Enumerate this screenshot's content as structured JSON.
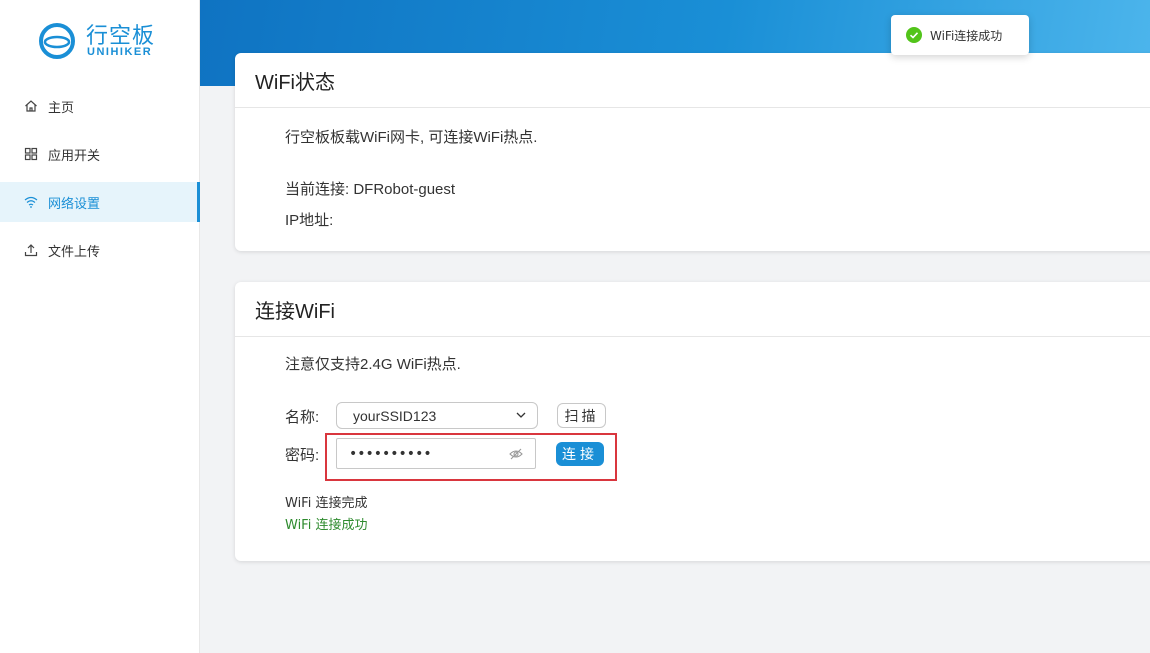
{
  "brand": {
    "title": "行空板",
    "subtitle": "UNIHIKER",
    "accent": "#1a8fd6"
  },
  "sidebar": {
    "items": [
      {
        "label": "主页",
        "icon": "home-icon",
        "active": false
      },
      {
        "label": "应用开关",
        "icon": "grid-icon",
        "active": false
      },
      {
        "label": "网络设置",
        "icon": "wifi-icon",
        "active": true
      },
      {
        "label": "文件上传",
        "icon": "upload-icon",
        "active": false
      }
    ]
  },
  "toast": {
    "text": "WiFi连接成功",
    "icon": "check-circle-icon",
    "color": "#52c41a"
  },
  "status_card": {
    "title": "WiFi状态",
    "description": "行空板板载WiFi网卡, 可连接WiFi热点.",
    "current_label": "当前连接: DFRobot-guest",
    "ip_label": "IP地址:"
  },
  "connect_card": {
    "title": "连接WiFi",
    "note": "注意仅支持2.4G WiFi热点.",
    "name_label": "名称:",
    "ssid_value": "yourSSID123",
    "scan_label": "扫描",
    "password_label": "密码:",
    "password_value": "••••••••••",
    "connect_label": "连接",
    "status_done": "WiFi 连接完成",
    "status_success": "WiFi 连接成功",
    "success_color": "#2e8b2e",
    "highlight_color": "#d9363e"
  }
}
